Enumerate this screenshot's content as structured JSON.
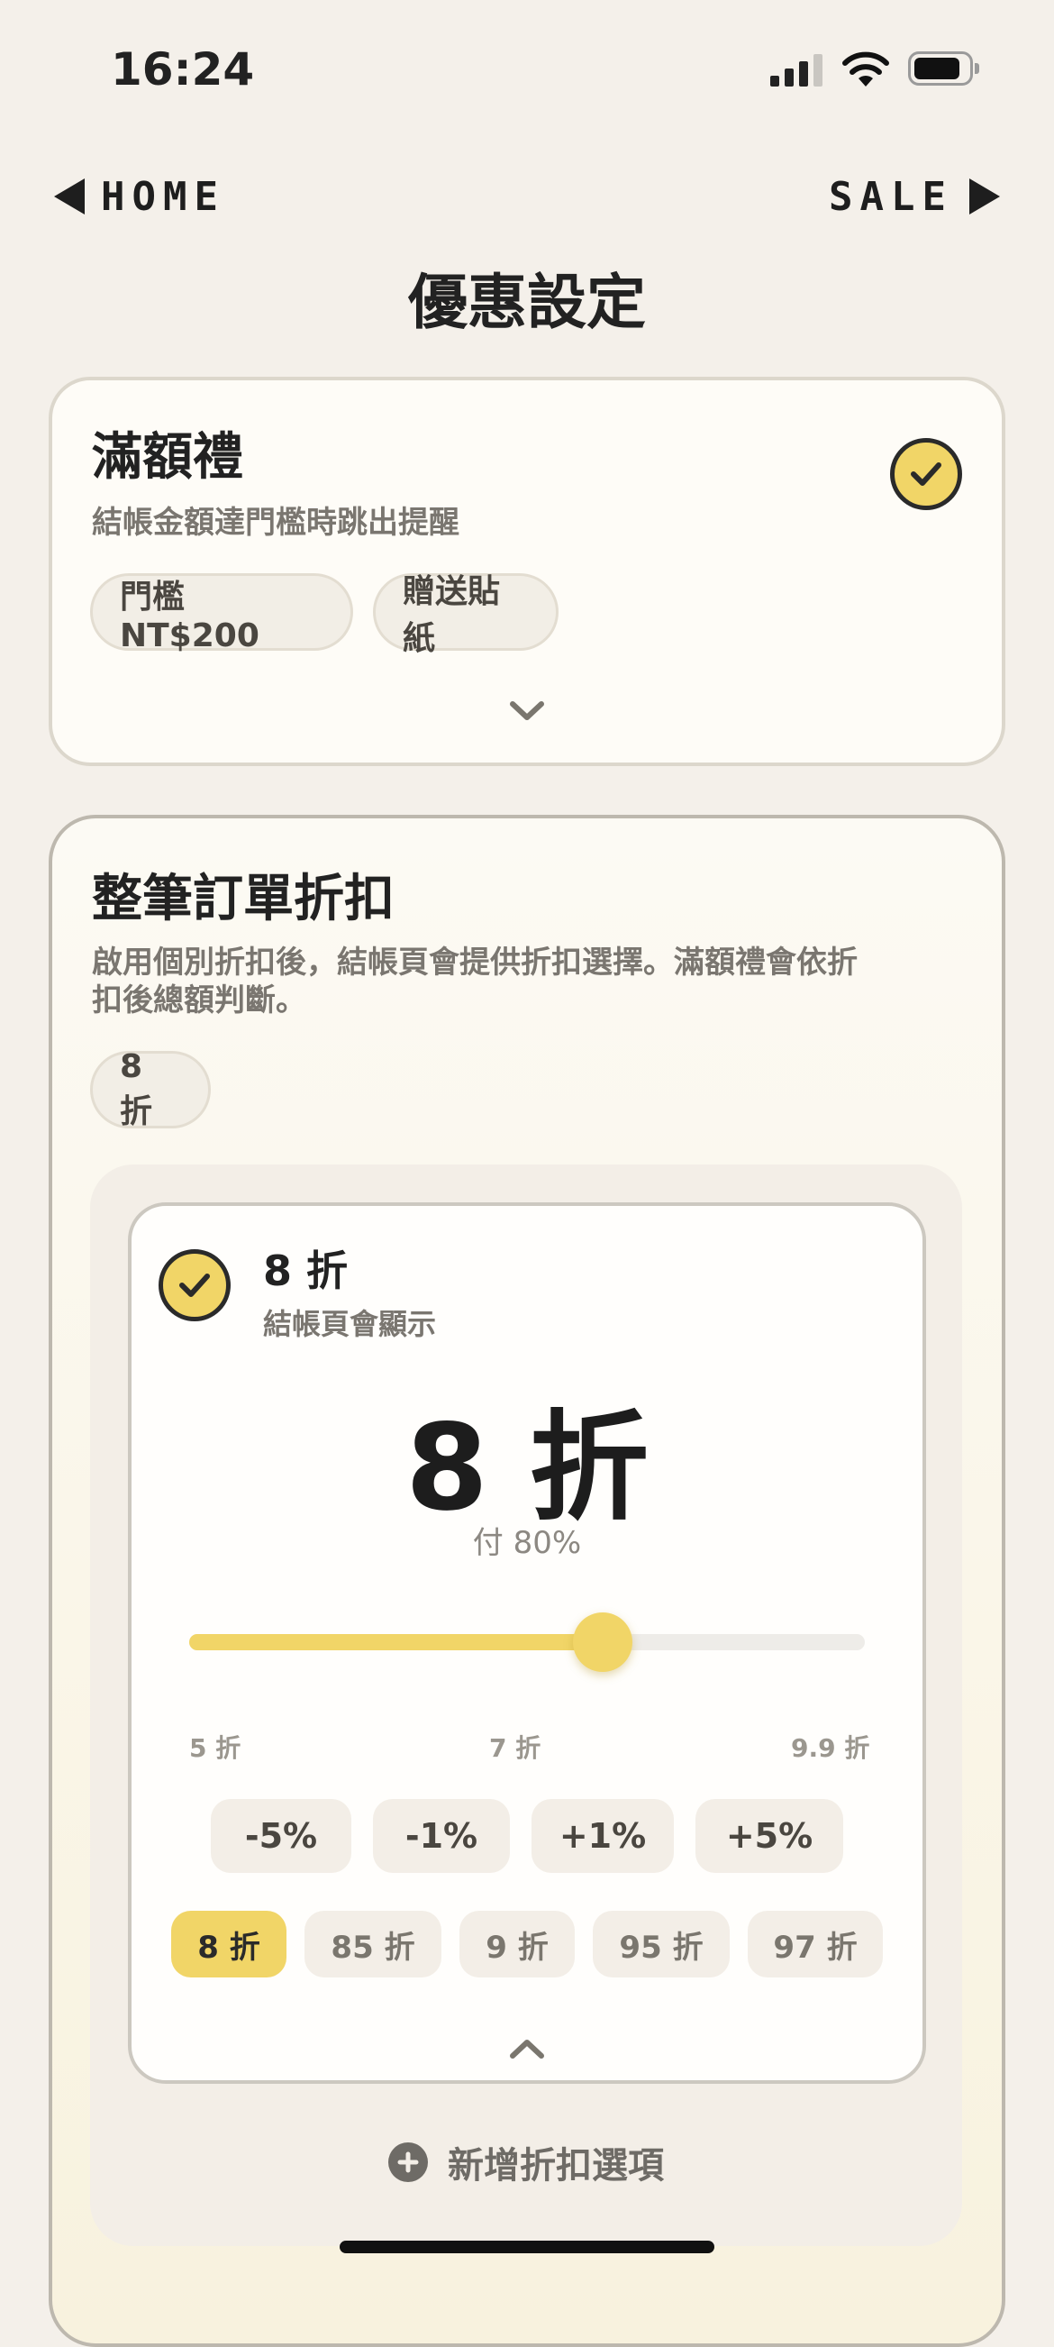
{
  "status_bar": {
    "time": "16:24"
  },
  "nav": {
    "back_label": "HOME",
    "forward_label": "SALE"
  },
  "page_title": "優惠設定",
  "gift_card": {
    "title": "滿額禮",
    "subtitle": "結帳金額達門檻時跳出提醒",
    "enabled": true,
    "chips": [
      "門檻 NT$200",
      "贈送貼紙"
    ],
    "expand_icon": "chevron-down-icon"
  },
  "discount_card": {
    "title": "整筆訂單折扣",
    "description_line1": "啟用個別折扣後，結帳頁會提供折扣選擇。滿額禮會依折",
    "description_line2": "扣後總額判斷。",
    "chips": [
      "8 折"
    ],
    "option": {
      "title": "8 折",
      "subtitle": "結帳頁會顯示",
      "enabled": true,
      "big_value": "8 折",
      "pay_text": "付 80%",
      "slider": {
        "min_label": "5 折",
        "mid_label": "7 折",
        "max_label": "9.9 折",
        "min": 5,
        "max": 9.9,
        "value": 8
      },
      "step_buttons": [
        "-5%",
        "-1%",
        "+1%",
        "+5%"
      ],
      "presets": [
        "8 折",
        "85 折",
        "9 折",
        "95 折",
        "97 折"
      ],
      "selected_preset": "8 折",
      "collapse_icon": "chevron-up-icon"
    },
    "add_option_label": "新增折扣選項"
  },
  "colors": {
    "accent": "#f1d567",
    "background": "#f4f0ea",
    "text": "#222222"
  }
}
